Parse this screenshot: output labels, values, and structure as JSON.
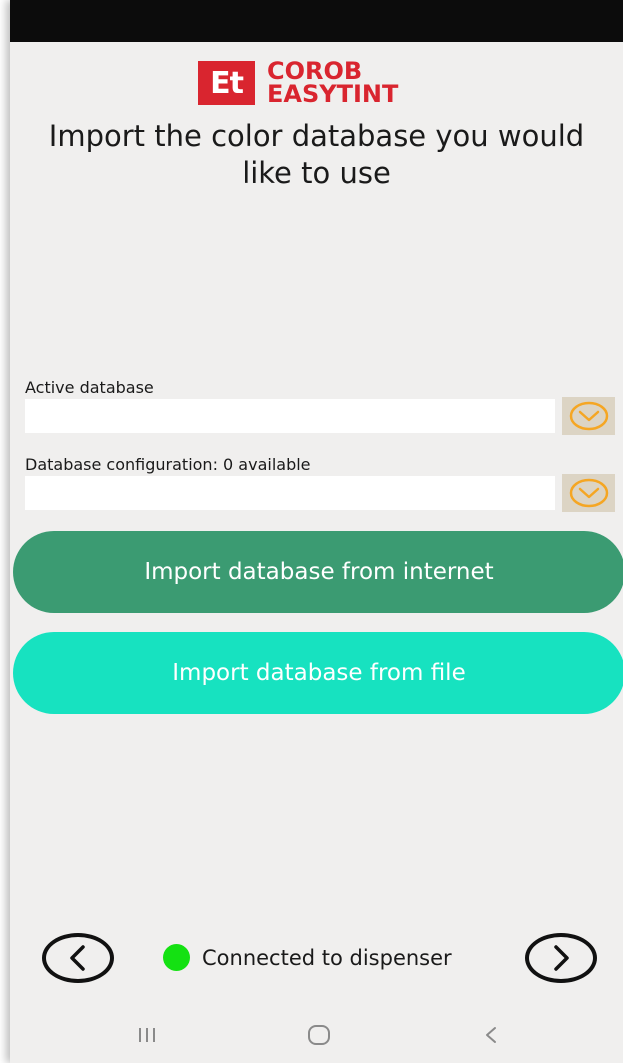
{
  "colors": {
    "brand_red": "#d9252f",
    "primary_button": "#3b9b72",
    "secondary_button": "#17e2c0",
    "connected_indicator": "#14e112",
    "dropdown_accent": "#f5a623"
  },
  "brand": {
    "badge": "Et",
    "name_line1": "COROB",
    "name_line2": "EASYTINT"
  },
  "headline": {
    "line1": "Import the color database you would",
    "line2": "like to use"
  },
  "fields": {
    "active_database": {
      "label": "Active database",
      "value": "",
      "icon": "chevron-down-icon"
    },
    "database_configuration": {
      "label": "Database configuration: 0 available",
      "value": "",
      "icon": "chevron-down-icon"
    }
  },
  "buttons": {
    "import_internet": "Import database from internet",
    "import_file": "Import database from file"
  },
  "footer": {
    "prev_icon": "chevron-left-icon",
    "next_icon": "chevron-right-icon",
    "status_text": "Connected to dispenser"
  },
  "system_nav": {
    "recents_icon": "recents-icon",
    "home_icon": "home-icon",
    "back_icon": "back-icon"
  }
}
